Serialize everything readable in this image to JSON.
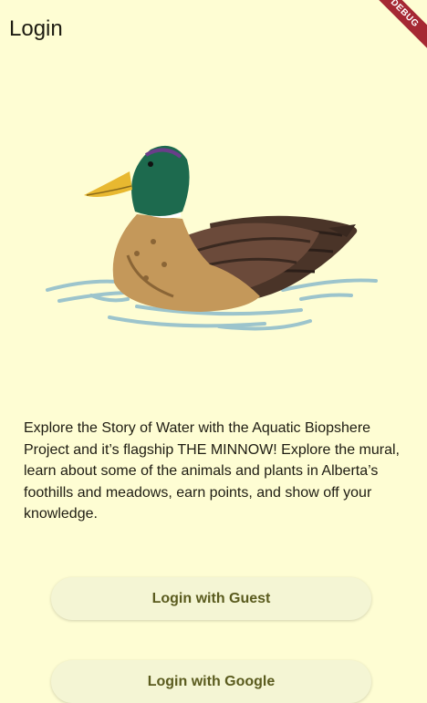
{
  "app_bar": {
    "title": "Login",
    "debug_banner": "DEBUG"
  },
  "illustration": {
    "icon": "mallard-duck-illustration"
  },
  "description": "Explore the Story of Water with the Aquatic Biopshere Project and it’s flagship THE MINNOW! Explore the mural, learn about some of the animals and plants in Alberta’s foothills and meadows, earn points, and show off your knowledge.",
  "buttons": {
    "guest_label": "Login with Guest",
    "google_label": "Login with Google"
  },
  "colors": {
    "background": "#fefdd3",
    "button_background": "#f4f5d4",
    "button_text": "#5a5b1e",
    "debug_banner": "#a52832"
  }
}
